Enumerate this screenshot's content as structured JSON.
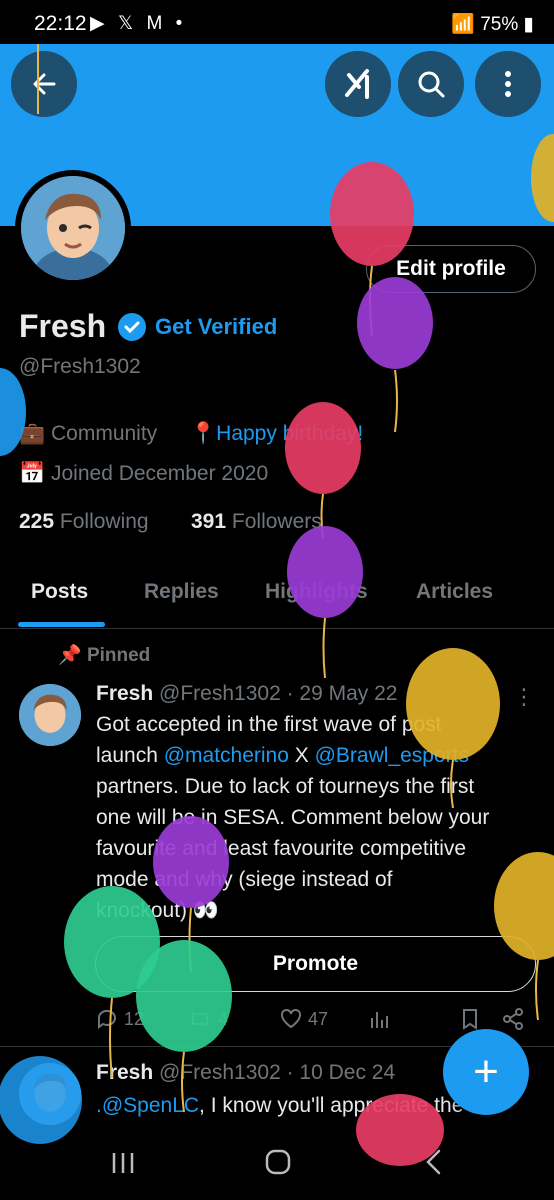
{
  "status_bar": {
    "time": "22:12",
    "notif_icons": "▶ 𝕏 M •",
    "battery": "75%"
  },
  "profile": {
    "name": "Fresh",
    "get_verified": "Get Verified",
    "handle": "@Fresh1302",
    "category": "Community",
    "location": "Happy birthday!",
    "joined": "Joined December 2020",
    "following_count": "225",
    "following_label": "Following",
    "followers_count": "391",
    "followers_label": "Followers",
    "edit_profile_label": "Edit profile"
  },
  "tabs": [
    "Posts",
    "Replies",
    "Highlights",
    "Articles"
  ],
  "pinned_label": "Pinned",
  "posts": [
    {
      "name": "Fresh",
      "handle": "@Fresh1302",
      "date": "· 29 May 22",
      "text_parts": {
        "l1": "Got accepted in the first wave of post",
        "l2a": "launch ",
        "mention1": "@matcherino",
        "l2b": " X ",
        "mention2": "@Brawl_esports",
        "l3": "partners. Due to lack of tourneys the first",
        "l4": "one will be in SESA. Comment below your",
        "l5": "favourite and least favourite competitive",
        "l6": "mode and why (siege instead of",
        "l7": "knockout) 👀"
      },
      "promote_label": "Promote",
      "replies": "12",
      "reposts": "4",
      "likes": "47"
    },
    {
      "name": "Fresh",
      "handle": "@Fresh1302",
      "date": "· 10 Dec 24",
      "mention": ".@SpenLC",
      "text": ", I know you'll appreciate the"
    }
  ],
  "colors": {
    "accent": "#1d9bf0",
    "background": "#000000",
    "banner": "#1d9bf0"
  }
}
